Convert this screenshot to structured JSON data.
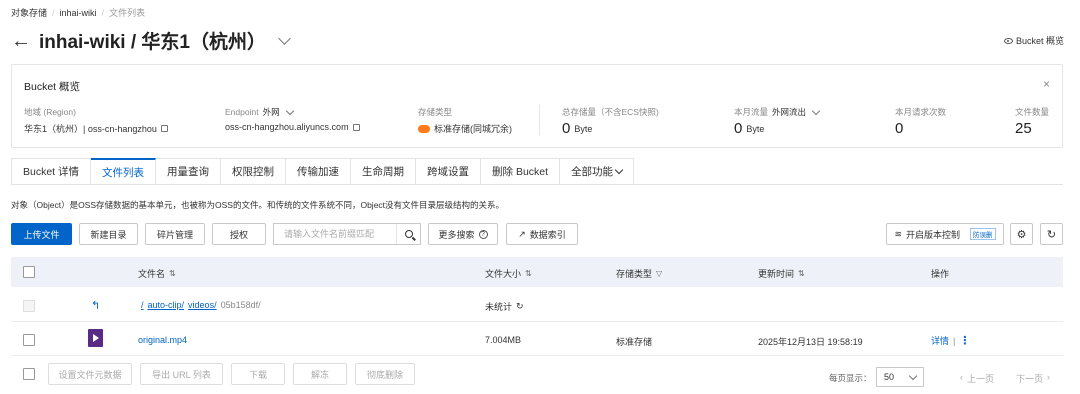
{
  "breadcrumb": [
    "对象存储",
    "inhai-wiki",
    "文件列表"
  ],
  "header": {
    "back_icon": "←",
    "title": "inhai-wiki / 华东1（杭州）",
    "bucket_overview_link": "Bucket 概览"
  },
  "overview_card": {
    "title": "Bucket 概览",
    "close": "×",
    "region": {
      "label": "地域 (Region)",
      "value": "华东1（杭州）| oss-cn-hangzhou"
    },
    "endpoint": {
      "label": "Endpoint",
      "selector": "外网",
      "value": "oss-cn-hangzhou.aliyuncs.com"
    },
    "storage_class": {
      "label": "存储类型",
      "value": "标准存储(同城冗余)"
    },
    "total_storage": {
      "label": "总存储量（不含ECS快照)",
      "value": "0",
      "unit": "Byte"
    },
    "monthly_traffic": {
      "label": "本月流量",
      "selector": "外网流出",
      "value": "0",
      "unit": "Byte"
    },
    "monthly_requests": {
      "label": "本月请求次数",
      "value": "0"
    },
    "file_count": {
      "label": "文件数量",
      "value": "25"
    }
  },
  "tabs": [
    "Bucket 详情",
    "文件列表",
    "用量查询",
    "权限控制",
    "传输加速",
    "生命周期",
    "跨域设置",
    "删除 Bucket",
    "全部功能"
  ],
  "active_tab": "文件列表",
  "description": "对象（Object）是OSS存储数据的基本单元，也被称为OSS的文件。和传统的文件系统不同，Object没有文件目录层级结构的关系。",
  "toolbar": {
    "upload": "上传文件",
    "new_dir": "新建目录",
    "fragments": "碎片管理",
    "authorize": "授权",
    "search_placeholder": "请输入文件名前缀匹配",
    "more_search": "更多搜索",
    "data_index": "数据索引",
    "versioning": "开启版本控制",
    "versioning_badge": "防误删"
  },
  "table": {
    "headers": {
      "name": "文件名",
      "size": "文件大小",
      "storage": "存储类型",
      "updated": "更新时间",
      "actions": "操作"
    },
    "path_row": {
      "root": "/",
      "seg1": "auto-clip/",
      "seg2": "videos/",
      "seg3": "05b158df/",
      "size": "未统计"
    },
    "rows": [
      {
        "name": "original.mp4",
        "size": "7.004MB",
        "storage": "标准存储",
        "updated": "2025年12月13日 19:58:19",
        "detail": "详情"
      }
    ]
  },
  "footer": {
    "buttons": [
      "设置文件元数据",
      "导出 URL 列表",
      "下载",
      "解冻",
      "彻底删除"
    ],
    "page_size_label": "每页显示：",
    "page_size": "50",
    "prev": "上一页",
    "next": "下一页"
  }
}
